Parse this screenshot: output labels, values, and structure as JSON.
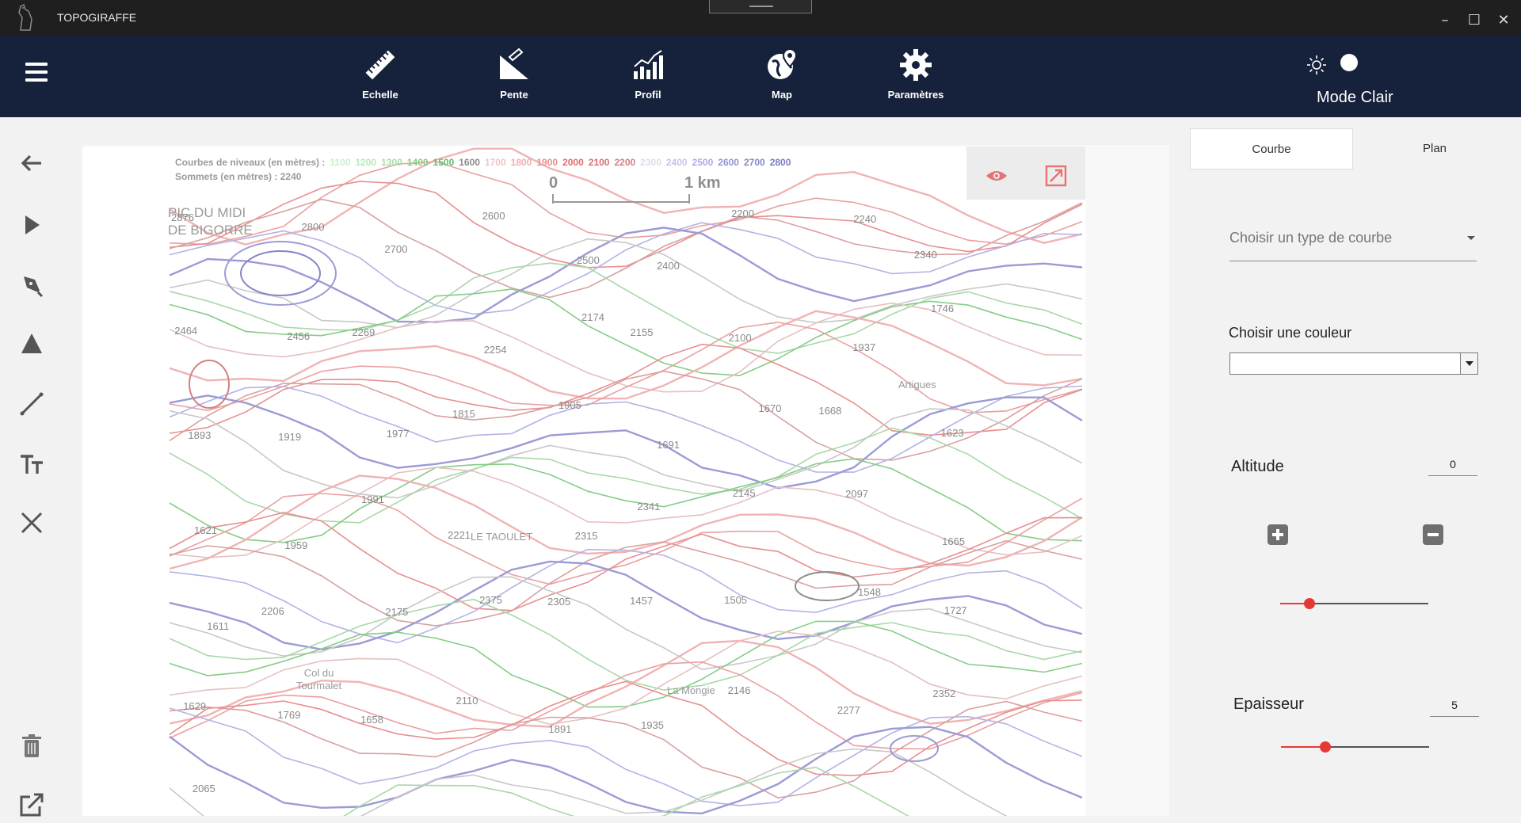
{
  "window": {
    "title": "TOPOGIRAFFE"
  },
  "toolbar": {
    "tools": [
      {
        "label": "Echelle",
        "icon": "ruler-icon"
      },
      {
        "label": "Pente",
        "icon": "slope-icon"
      },
      {
        "label": "Profil",
        "icon": "profile-chart-icon"
      },
      {
        "label": "Map",
        "icon": "globe-pin-icon"
      },
      {
        "label": "Paramètres",
        "icon": "gear-icon"
      }
    ],
    "mode_label": "Mode Clair"
  },
  "sidebar": {
    "tools": [
      "back-arrow-icon",
      "select-pointer-icon",
      "pen-icon",
      "triangle-peak-icon",
      "line-icon",
      "text-icon",
      "close-icon",
      "trash-icon",
      "export-icon"
    ]
  },
  "map": {
    "legend_curves_label": "Courbes de niveaux (en mètres) :",
    "legend_levels": [
      {
        "v": "1100",
        "c": "#c9efc9"
      },
      {
        "v": "1200",
        "c": "#b9e8b9"
      },
      {
        "v": "1300",
        "c": "#a3dfa3"
      },
      {
        "v": "1400",
        "c": "#7fd07f"
      },
      {
        "v": "1500",
        "c": "#5dbd6b"
      },
      {
        "v": "1600",
        "c": "#8c8c8c"
      },
      {
        "v": "1700",
        "c": "#f2c3c3"
      },
      {
        "v": "1800",
        "c": "#eeb0b0"
      },
      {
        "v": "1900",
        "c": "#e88f8f"
      },
      {
        "v": "2000",
        "c": "#e26b6b"
      },
      {
        "v": "2100",
        "c": "#d97070"
      },
      {
        "v": "2200",
        "c": "#d48080"
      },
      {
        "v": "2300",
        "c": "#dcdcf0"
      },
      {
        "v": "2400",
        "c": "#c4c4ec"
      },
      {
        "v": "2500",
        "c": "#aaaae4"
      },
      {
        "v": "2600",
        "c": "#9292d8"
      },
      {
        "v": "2700",
        "c": "#8585cc"
      },
      {
        "v": "2800",
        "c": "#7a7ac4"
      }
    ],
    "legend_peaks_label": "Sommets (en mètres) :",
    "legend_peaks_value": "2240",
    "scale_start": "0",
    "scale_end": "1 km",
    "places": [
      {
        "text": "PIC DU MIDI\nDE BIGORRE",
        "key": "pic"
      },
      {
        "text": "LE TAOULET",
        "key": "taoulet"
      },
      {
        "text": "Col du\nTourmalet",
        "key": "col"
      },
      {
        "text": "La Mongie",
        "key": "mongie"
      },
      {
        "text": "Artigues",
        "key": "artigues"
      }
    ],
    "peaks": [
      "2876",
      "2800",
      "2700",
      "2600",
      "2500",
      "2400",
      "2200",
      "2240",
      "2340",
      "2464",
      "2456",
      "2269",
      "2254",
      "2174",
      "2155",
      "2100",
      "1937",
      "1746",
      "1893",
      "1919",
      "1977",
      "1815",
      "1905",
      "1691",
      "1670",
      "1668",
      "1623",
      "1621",
      "1959",
      "1991",
      "2221",
      "2315",
      "2341",
      "2145",
      "2097",
      "1665",
      "1611",
      "2206",
      "2175",
      "2375",
      "2305",
      "1457",
      "1505",
      "1548",
      "1727",
      "1629",
      "1769",
      "1658",
      "2110",
      "1891",
      "1935",
      "2146",
      "2277",
      "2352",
      "2065"
    ]
  },
  "panel": {
    "tabs": [
      "Courbe",
      "Plan"
    ],
    "curve_type_placeholder": "Choisir un type de courbe",
    "color_label": "Choisir une couleur",
    "altitude_label": "Altitude",
    "altitude_value": "0",
    "altitude_slider": 0.2,
    "thickness_label": "Epaisseur",
    "thickness_value": "5",
    "thickness_slider": 0.3,
    "accent": "#e53935"
  }
}
